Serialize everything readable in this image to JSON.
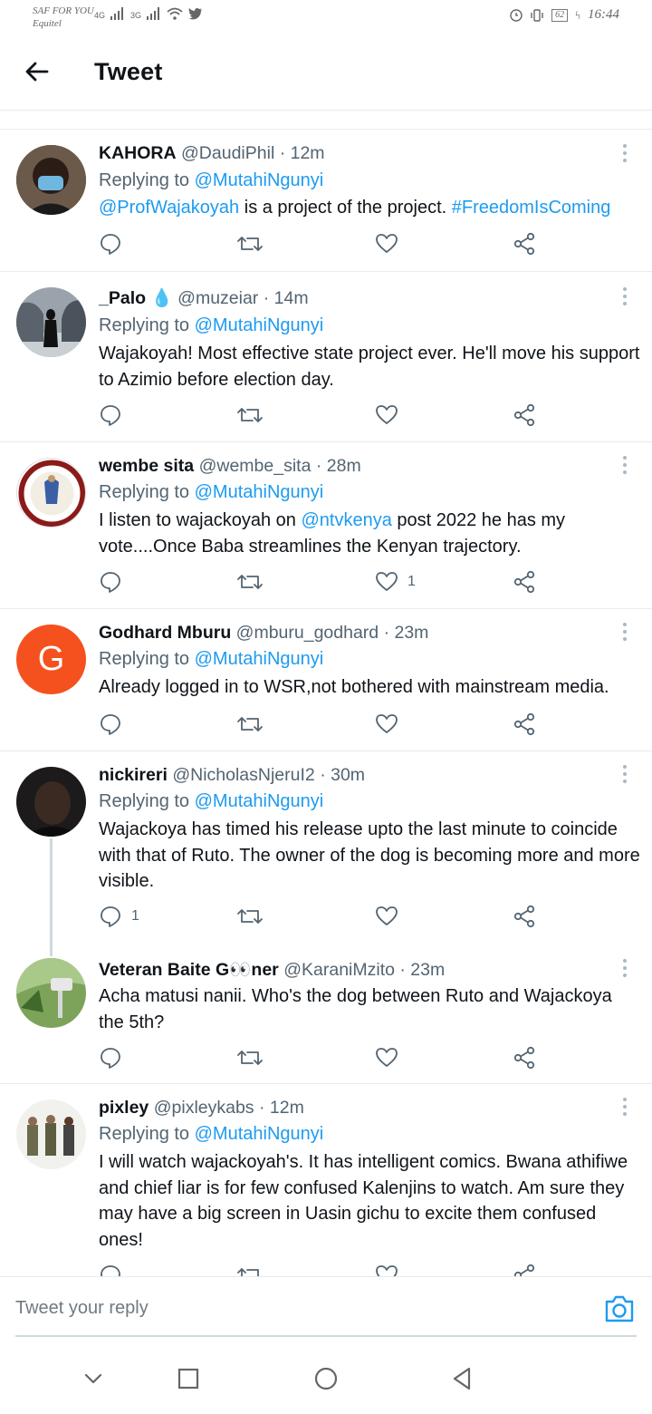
{
  "status_bar": {
    "carrier": "SAF FOR YOU",
    "carrier_sub": "Equitel",
    "net1": "4G",
    "net2": "3G",
    "battery": "62",
    "time": "16:44"
  },
  "header": {
    "title": "Tweet"
  },
  "colors": {
    "accent": "#1d9bf0",
    "secondary_text": "#536471",
    "divider": "#e6ecf0",
    "avatar_g": "#f4511e"
  },
  "tweets": [
    {
      "name": "KAHORA",
      "handle": "@DaudiPhil",
      "time": "· 12m",
      "replying_prefix": "Replying to",
      "replying_to": "@MutahiNgunyi",
      "text_mention": "@ProfWajakoyah",
      "text_body": " is a project of the project. ",
      "text_hashtag": "#FreedomIsComing",
      "reply_count": "",
      "like_count": ""
    },
    {
      "name": "_Palo",
      "emoji": "💧",
      "handle": "@muzeiar",
      "time": "· 14m",
      "replying_prefix": "Replying to",
      "replying_to": "@MutahiNgunyi",
      "text": "Wajakoyah! Most effective state project ever. He'll move his support to Azimio before election day.",
      "reply_count": "",
      "like_count": ""
    },
    {
      "name": "wembe sita",
      "handle": "@wembe_sita",
      "time": "· 28m",
      "replying_prefix": "Replying to",
      "replying_to": "@MutahiNgunyi",
      "text_pre": "I listen to wajackoyah on ",
      "text_mention": "@ntvkenya",
      "text_post": " post 2022 he has my vote....Once Baba streamlines the Kenyan trajectory.",
      "reply_count": "",
      "like_count": "1"
    },
    {
      "name": "Godhard Mburu",
      "handle": "@mburu_godhard",
      "time": "· 23m",
      "avatar_letter": "G",
      "replying_prefix": "Replying to",
      "replying_to": "@MutahiNgunyi",
      "text": "Already logged in to WSR,not bothered with mainstream media.",
      "reply_count": "",
      "like_count": ""
    },
    {
      "name": "nickireri",
      "handle": "@NicholasNjeruI2",
      "time": "· 30m",
      "replying_prefix": "Replying to",
      "replying_to": "@MutahiNgunyi",
      "text": "Wajackoya has timed his release upto the last minute to coincide with that of Ruto. The owner of the dog is becoming more and more visible.",
      "reply_count": "1",
      "like_count": ""
    },
    {
      "name": "Veteran Baite G👀ner",
      "handle": "@KaraniMzito",
      "time": "· 23m",
      "text": "Acha matusi nanii.  Who's the dog between Ruto and Wajackoya the 5th?",
      "reply_count": "",
      "like_count": ""
    },
    {
      "name": "pixley",
      "handle": "@pixleykabs",
      "time": "· 12m",
      "replying_prefix": "Replying to",
      "replying_to": "@MutahiNgunyi",
      "text": "I will watch wajackoyah's. It has intelligent comics. Bwana athifiwe and chief liar is for few confused Kalenjins to watch. Am sure they may have a big screen in Uasin gichu to excite them confused ones!",
      "reply_count": "",
      "like_count": ""
    }
  ],
  "reply_bar": {
    "placeholder": "Tweet your reply"
  }
}
